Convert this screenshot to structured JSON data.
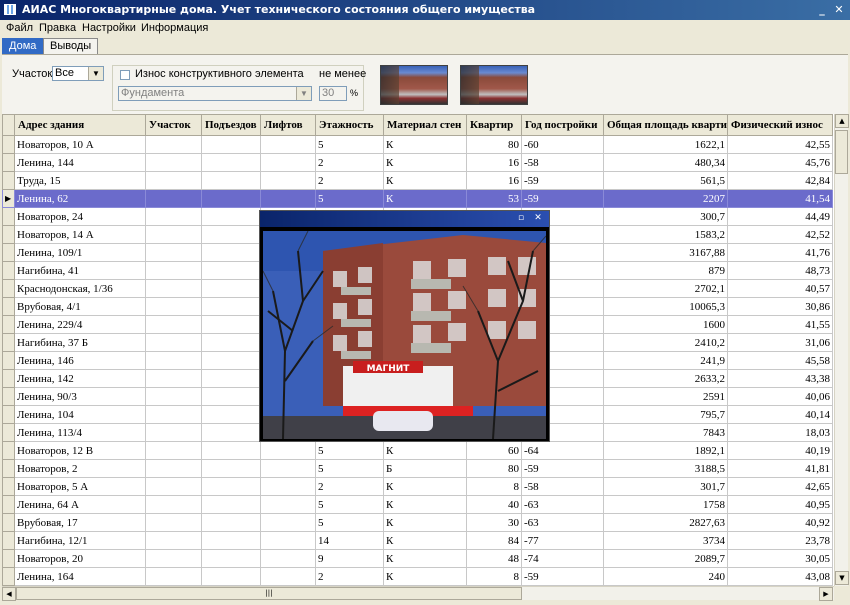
{
  "window": {
    "title": "АИАС Многоквартирные дома. Учет технического состояния общего имущества",
    "controls": {
      "minimize": "_",
      "close": "✕"
    }
  },
  "menu": [
    {
      "label": "Файл"
    },
    {
      "label": "Правка"
    },
    {
      "label": "Настройки"
    },
    {
      "label": "Информация"
    }
  ],
  "tabs": [
    {
      "label": "Дома",
      "active": true
    },
    {
      "label": "Выводы",
      "active": false
    }
  ],
  "filter": {
    "district_label": "Участок",
    "district_value": "Все",
    "wear_checkbox_label": "Износ конструктивного элемента",
    "wear_checked": false,
    "element_value": "Фундамента",
    "min_label": "не менее",
    "min_value": "30",
    "percent": "%"
  },
  "table": {
    "columns": [
      "Адрес здания",
      "Участок",
      "Подъездов",
      "Лифтов",
      "Этажность",
      "Материал стен",
      "Квартир",
      "Год постройки",
      "Общая площадь квартир",
      "Физический износ"
    ],
    "rows": [
      {
        "address": "Новаторов, 10 А",
        "district": "",
        "entrances": "",
        "lifts": "",
        "floors": "5",
        "walls": "К",
        "flats": "80",
        "year": "-60",
        "area": "1622,1",
        "wear": "42,55"
      },
      {
        "address": "Ленина, 144",
        "district": "",
        "entrances": "",
        "lifts": "",
        "floors": "2",
        "walls": "К",
        "flats": "16",
        "year": "-58",
        "area": "480,34",
        "wear": "45,76"
      },
      {
        "address": "Труда, 15",
        "district": "",
        "entrances": "",
        "lifts": "",
        "floors": "2",
        "walls": "К",
        "flats": "16",
        "year": "-59",
        "area": "561,5",
        "wear": "42,84"
      },
      {
        "address": "Ленина, 62",
        "district": "",
        "entrances": "",
        "lifts": "",
        "floors": "5",
        "walls": "К",
        "flats": "53",
        "year": "-59",
        "area": "2207",
        "wear": "41,54",
        "selected": true
      },
      {
        "address": "Новаторов, 24",
        "district": "",
        "entrances": "",
        "lifts": "",
        "floors": "",
        "walls": "",
        "flats": "",
        "year": "",
        "area": "300,7",
        "wear": "44,49"
      },
      {
        "address": "Новаторов, 14 А",
        "district": "",
        "entrances": "",
        "lifts": "",
        "floors": "",
        "walls": "",
        "flats": "",
        "year": "",
        "area": "1583,2",
        "wear": "42,52"
      },
      {
        "address": "Ленина, 109/1",
        "district": "",
        "entrances": "",
        "lifts": "",
        "floors": "",
        "walls": "",
        "flats": "",
        "year": "",
        "area": "3167,88",
        "wear": "41,76"
      },
      {
        "address": "Нагибина, 41",
        "district": "",
        "entrances": "",
        "lifts": "",
        "floors": "",
        "walls": "",
        "flats": "",
        "year": "",
        "area": "879",
        "wear": "48,73"
      },
      {
        "address": "Краснодонская, 1/36",
        "district": "",
        "entrances": "",
        "lifts": "",
        "floors": "",
        "walls": "",
        "flats": "",
        "year": "",
        "area": "2702,1",
        "wear": "40,57"
      },
      {
        "address": "Врубовая, 4/1",
        "district": "",
        "entrances": "",
        "lifts": "",
        "floors": "",
        "walls": "",
        "flats": "",
        "year": "",
        "area": "10065,3",
        "wear": "30,86"
      },
      {
        "address": "Ленина, 229/4",
        "district": "",
        "entrances": "",
        "lifts": "",
        "floors": "",
        "walls": "",
        "flats": "",
        "year": "",
        "area": "1600",
        "wear": "41,55"
      },
      {
        "address": "Нагибина, 37 Б",
        "district": "",
        "entrances": "",
        "lifts": "",
        "floors": "",
        "walls": "",
        "flats": "",
        "year": "",
        "area": "2410,2",
        "wear": "31,06"
      },
      {
        "address": "Ленина, 146",
        "district": "",
        "entrances": "",
        "lifts": "",
        "floors": "",
        "walls": "",
        "flats": "",
        "year": "",
        "area": "241,9",
        "wear": "45,58"
      },
      {
        "address": "Ленина, 142",
        "district": "",
        "entrances": "",
        "lifts": "",
        "floors": "",
        "walls": "",
        "flats": "",
        "year": "",
        "area": "2633,2",
        "wear": "43,38"
      },
      {
        "address": "Ленина, 90/3",
        "district": "",
        "entrances": "",
        "lifts": "",
        "floors": "",
        "walls": "",
        "flats": "",
        "year": "",
        "area": "2591",
        "wear": "40,06"
      },
      {
        "address": "Ленина, 104",
        "district": "",
        "entrances": "",
        "lifts": "",
        "floors": "",
        "walls": "",
        "flats": "",
        "year": "",
        "area": "795,7",
        "wear": "40,14"
      },
      {
        "address": "Ленина, 113/4",
        "district": "",
        "entrances": "",
        "lifts": "",
        "floors": "",
        "walls": "",
        "flats": "",
        "year": "",
        "area": "7843",
        "wear": "18,03"
      },
      {
        "address": "Новаторов, 12 В",
        "district": "",
        "entrances": "",
        "lifts": "",
        "floors": "5",
        "walls": "К",
        "flats": "60",
        "year": "-64",
        "area": "1892,1",
        "wear": "40,19"
      },
      {
        "address": "Новаторов, 2",
        "district": "",
        "entrances": "",
        "lifts": "",
        "floors": "5",
        "walls": "Б",
        "flats": "80",
        "year": "-59",
        "area": "3188,5",
        "wear": "41,81"
      },
      {
        "address": "Новаторов, 5 А",
        "district": "",
        "entrances": "",
        "lifts": "",
        "floors": "2",
        "walls": "К",
        "flats": "8",
        "year": "-58",
        "area": "301,7",
        "wear": "42,65"
      },
      {
        "address": "Ленина, 64 А",
        "district": "",
        "entrances": "",
        "lifts": "",
        "floors": "5",
        "walls": "К",
        "flats": "40",
        "year": "-63",
        "area": "1758",
        "wear": "40,95"
      },
      {
        "address": "Врубовая, 17",
        "district": "",
        "entrances": "",
        "lifts": "",
        "floors": "5",
        "walls": "К",
        "flats": "30",
        "year": "-63",
        "area": "2827,63",
        "wear": "40,92"
      },
      {
        "address": "Нагибина, 12/1",
        "district": "",
        "entrances": "",
        "lifts": "",
        "floors": "14",
        "walls": "К",
        "flats": "84",
        "year": "-77",
        "area": "3734",
        "wear": "23,78"
      },
      {
        "address": "Новаторов, 20",
        "district": "",
        "entrances": "",
        "lifts": "",
        "floors": "9",
        "walls": "К",
        "flats": "48",
        "year": "-74",
        "area": "2089,7",
        "wear": "30,05"
      },
      {
        "address": "Ленина, 164",
        "district": "",
        "entrances": "",
        "lifts": "",
        "floors": "2",
        "walls": "К",
        "flats": "8",
        "year": "-59",
        "area": "240",
        "wear": "43,08"
      }
    ]
  },
  "photo_popup": {
    "sign_text": "МАГНИТ",
    "controls": {
      "maximize": "▫",
      "close": "✕"
    }
  },
  "colors": {
    "title_bar": "#0a246a",
    "selection": "#6b6bcb",
    "tab_active": "#316ac5"
  }
}
